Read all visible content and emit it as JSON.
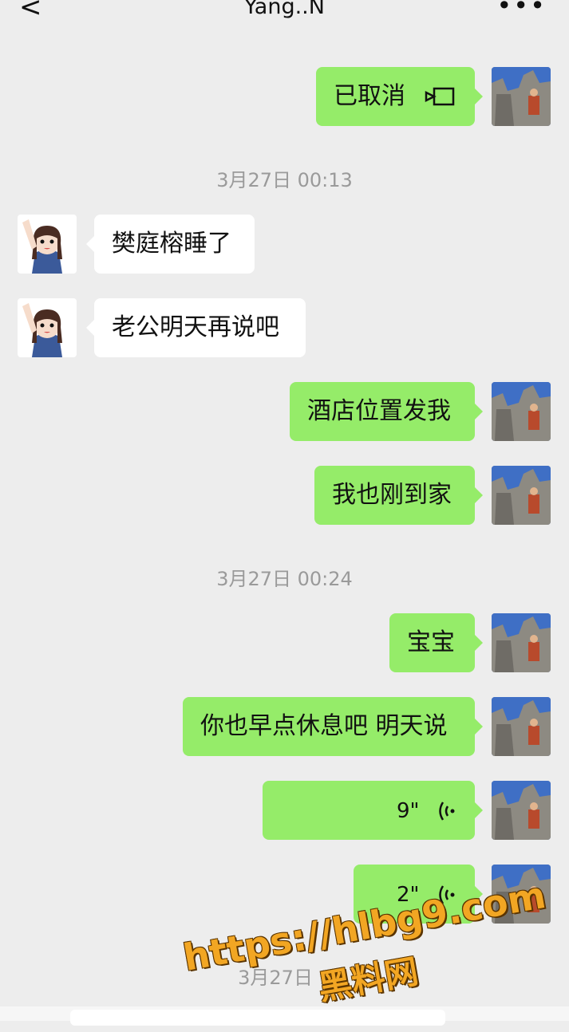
{
  "header": {
    "back": "<",
    "title": "Yang..N",
    "more": "•••"
  },
  "colors": {
    "me_bubble": "#95ec69",
    "her_bubble": "#ffffff",
    "background": "#ededed"
  },
  "messages": [
    {
      "type": "msg",
      "side": "me",
      "text": "已取消",
      "icon": "video-call-icon"
    },
    {
      "type": "time",
      "text": "3月27日 00:13"
    },
    {
      "type": "msg",
      "side": "her",
      "text": "樊庭榕睡了"
    },
    {
      "type": "msg",
      "side": "her",
      "text": "老公明天再说吧"
    },
    {
      "type": "msg",
      "side": "me",
      "text": "酒店位置发我"
    },
    {
      "type": "msg",
      "side": "me",
      "text": "我也刚到家"
    },
    {
      "type": "time",
      "text": "3月27日 00:24"
    },
    {
      "type": "msg",
      "side": "me",
      "text": "宝宝"
    },
    {
      "type": "msg",
      "side": "me",
      "text": "你也早点休息吧 明天说"
    },
    {
      "type": "voice",
      "side": "me",
      "duration": "9\""
    },
    {
      "type": "voice",
      "side": "me",
      "duration": "2\""
    },
    {
      "type": "time",
      "text": "3月27日 1"
    }
  ],
  "watermark": {
    "url": "https://hlbg9.com",
    "site": "黑料网"
  }
}
